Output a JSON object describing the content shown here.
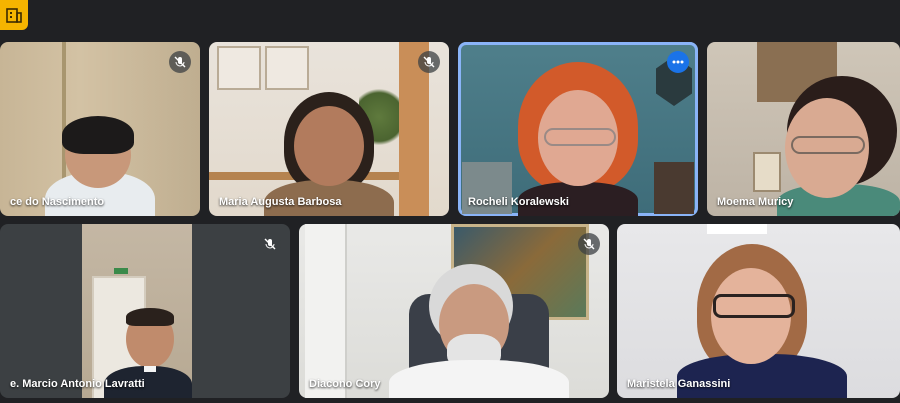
{
  "app": {
    "icon": "building-logo-icon",
    "accent": "#f5b400"
  },
  "tiles": [
    {
      "name": "ce do Nascimento",
      "mic": "mic-off-icon"
    },
    {
      "name": "Maria Augusta Barbosa",
      "mic": "mic-off-icon"
    },
    {
      "name": "Rocheli Koralewski",
      "active": true,
      "menu": "more-options-icon"
    },
    {
      "name": "Moema Muricy"
    },
    {
      "name": "e. Marcio Antonio Lavratti",
      "mic": "mic-off-icon"
    },
    {
      "name": "Diacono Cory",
      "mic": "mic-off-icon"
    },
    {
      "name": "Maristela Ganassini"
    }
  ],
  "colors": {
    "active_border": "#8ab4f8",
    "background": "#202124",
    "menu_button": "#1a73e8"
  }
}
